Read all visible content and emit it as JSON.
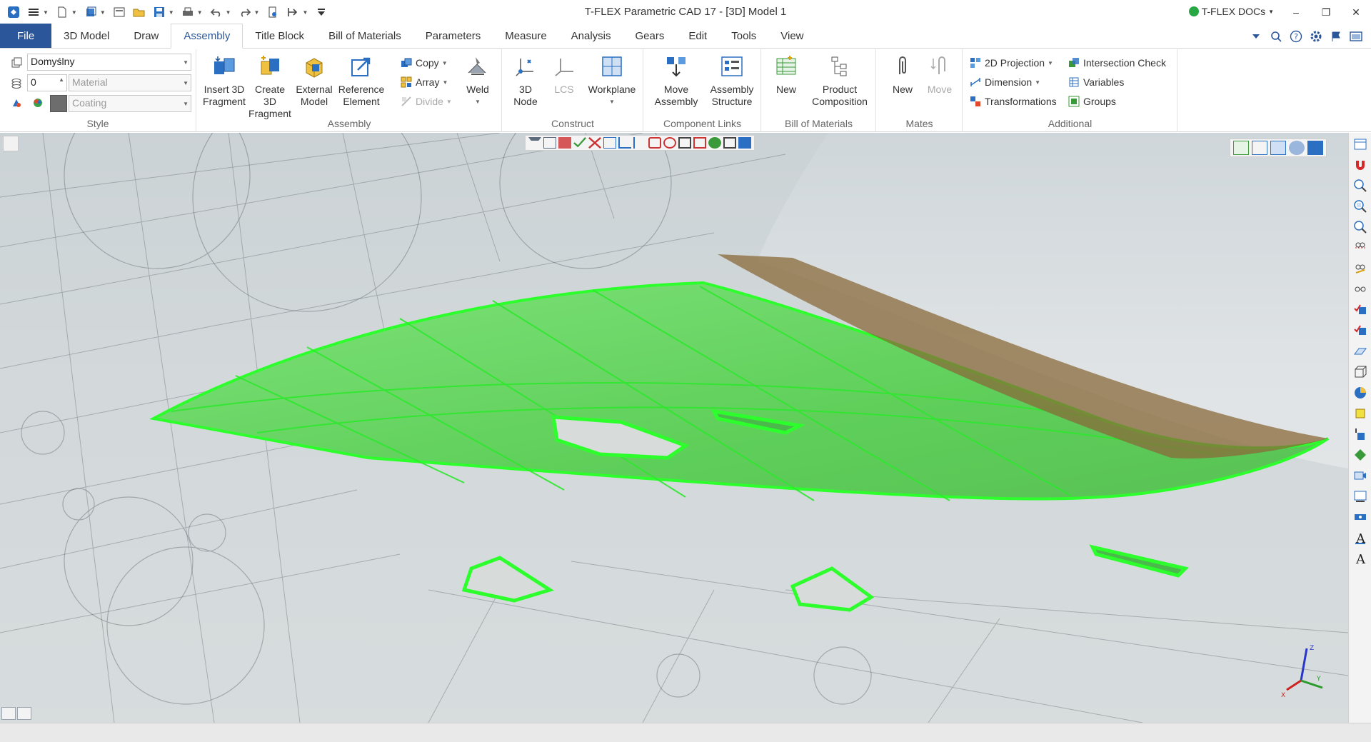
{
  "window": {
    "title": "T-FLEX Parametric CAD 17 - [3D] Model 1",
    "docs_label": "T-FLEX DOCs",
    "minimize": "–",
    "restore": "❐",
    "close": "✕"
  },
  "menu": {
    "file": "File",
    "tabs": [
      "3D Model",
      "Draw",
      "Assembly",
      "Title Block",
      "Bill of Materials",
      "Parameters",
      "Measure",
      "Analysis",
      "Gears",
      "Edit",
      "Tools",
      "View"
    ],
    "active_tab": "Assembly"
  },
  "ribbon": {
    "style": {
      "label": "Style",
      "layer_value": "Domyślny",
      "level_value": "0",
      "material_placeholder": "Material",
      "coating_placeholder": "Coating"
    },
    "assembly": {
      "label": "Assembly",
      "insert_fragment": "Insert 3D\nFragment",
      "insert_line1": "Insert 3D",
      "insert_line2": "Fragment",
      "create_line1": "Create 3D",
      "create_line2": "Fragment",
      "external_line1": "External",
      "external_line2": "Model",
      "reference_line1": "Reference",
      "reference_line2": "Element",
      "copy": "Copy",
      "array": "Array",
      "divide": "Divide",
      "weld": "Weld"
    },
    "construct": {
      "label": "Construct",
      "node_line1": "3D",
      "node_line2": "Node",
      "lcs": "LCS",
      "workplane": "Workplane"
    },
    "component_links": {
      "label": "Component Links",
      "move_line1": "Move",
      "move_line2": "Assembly",
      "structure_line1": "Assembly",
      "structure_line2": "Structure"
    },
    "bom": {
      "label": "Bill of Materials",
      "new": "New",
      "product_line1": "Product",
      "product_line2": "Composition"
    },
    "mates": {
      "label": "Mates",
      "new": "New",
      "move": "Move"
    },
    "additional": {
      "label": "Additional",
      "projection_2d": "2D Projection",
      "intersection_check": "Intersection Check",
      "dimension": "Dimension",
      "variables": "Variables",
      "transformations": "Transformations",
      "groups": "Groups"
    }
  },
  "triad": {
    "x": "X",
    "y": "Y",
    "z": "Z"
  },
  "colors": {
    "file_tab": "#2b579a",
    "selection_green": "#3ddc3d",
    "ribbon_bg": "#ffffff"
  }
}
